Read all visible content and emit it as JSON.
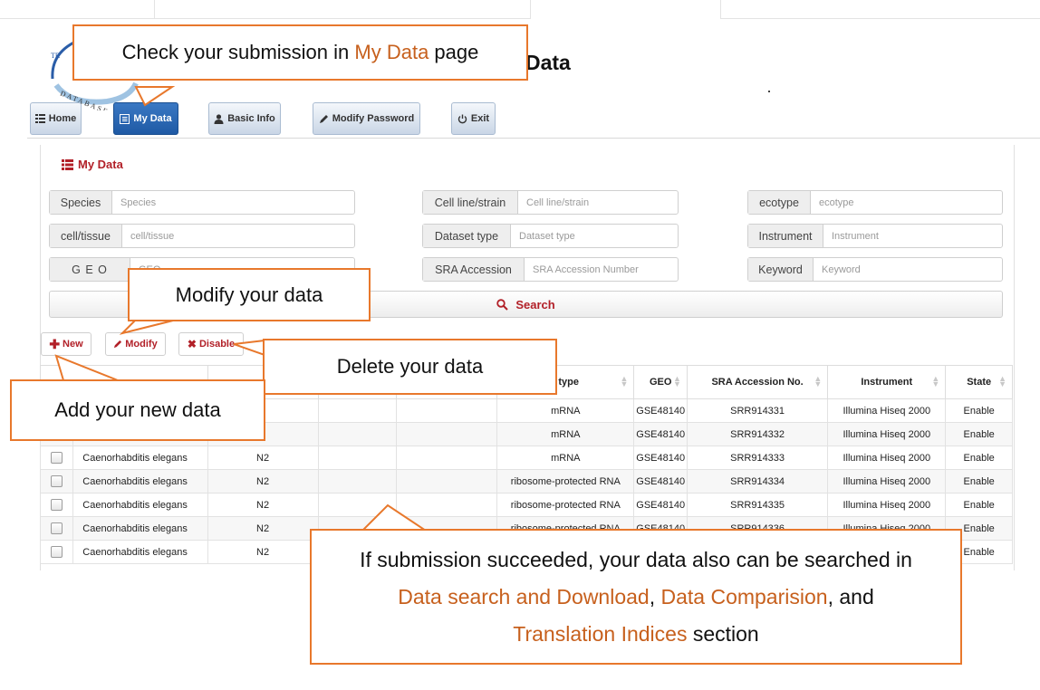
{
  "site": {
    "logo_text_top": "TR",
    "logo_text_bottom": "DATABASE",
    "page_title_suffix": "Data"
  },
  "nav": {
    "buttons": [
      {
        "label": "Home",
        "icon": "grid-icon",
        "active": false
      },
      {
        "label": "My Data",
        "icon": "list-alt-icon",
        "active": true
      },
      {
        "label": "Basic Info",
        "icon": "user-icon",
        "active": false
      },
      {
        "label": "Modify Password",
        "icon": "pencil-icon",
        "active": false
      },
      {
        "label": "Exit",
        "icon": "power-icon",
        "active": false
      }
    ]
  },
  "panel": {
    "title": "My Data",
    "title_icon": "list-icon",
    "fields": [
      {
        "label": "Species",
        "placeholder": "Species",
        "value": ""
      },
      {
        "label": "Cell line/strain",
        "placeholder": "Cell line/strain",
        "value": ""
      },
      {
        "label": "ecotype",
        "placeholder": "ecotype",
        "value": ""
      },
      {
        "label": "cell/tissue",
        "placeholder": "cell/tissue",
        "value": ""
      },
      {
        "label": "Dataset type",
        "placeholder": "Dataset type",
        "value": ""
      },
      {
        "label": "Instrument",
        "placeholder": "Instrument",
        "value": ""
      },
      {
        "label": "G E O",
        "placeholder": "GEO",
        "value": ""
      },
      {
        "label": "SRA Accession",
        "placeholder": "SRA Accession Number",
        "value": ""
      },
      {
        "label": "Keyword",
        "placeholder": "Keyword",
        "value": ""
      }
    ],
    "search_label": "Search",
    "actions": {
      "new": "New",
      "modify": "Modify",
      "disable": "Disable"
    }
  },
  "table": {
    "headers": [
      "",
      "",
      "",
      "",
      "",
      "Dataset type",
      "GEO",
      "SRA Accession No.",
      "Instrument",
      "State"
    ],
    "visible_header_fragments": {
      "col4": "t type"
    },
    "rows": [
      [
        "",
        "",
        "",
        "",
        "",
        "mRNA",
        "GSE48140",
        "SRR914331",
        "Illumina Hiseq 2000",
        "Enable"
      ],
      [
        "",
        "",
        "",
        "",
        "",
        "mRNA",
        "GSE48140",
        "SRR914332",
        "Illumina Hiseq 2000",
        "Enable"
      ],
      [
        "",
        "Caenorhabditis elegans",
        "N2",
        "",
        "",
        "mRNA",
        "GSE48140",
        "SRR914333",
        "Illumina Hiseq 2000",
        "Enable"
      ],
      [
        "",
        "Caenorhabditis elegans",
        "N2",
        "",
        "",
        "ribosome-protected RNA",
        "GSE48140",
        "SRR914334",
        "Illumina Hiseq 2000",
        "Enable"
      ],
      [
        "",
        "Caenorhabditis elegans",
        "N2",
        "",
        "",
        "ribosome-protected RNA",
        "GSE48140",
        "SRR914335",
        "Illumina Hiseq 2000",
        "Enable"
      ],
      [
        "",
        "Caenorhabditis elegans",
        "N2",
        "",
        "",
        "ribosome-protected RNA",
        "GSE48140",
        "SRR914336",
        "Illumina Hiseq 2000",
        "Enable"
      ],
      [
        "",
        "Caenorhabditis elegans",
        "N2",
        "",
        "",
        "",
        "",
        "",
        "",
        "Enable"
      ]
    ]
  },
  "callouts": {
    "check": {
      "pre": "Check your submission in ",
      "link": "My Data",
      "post": " page"
    },
    "modify": "Modify your data",
    "delete": "Delete your data",
    "add": "Add your new data",
    "info": {
      "line1": "If submission succeeded, your data also can be searched in",
      "link1": "Data search and Download",
      "sep1": ", ",
      "link2": "Data Comparision",
      "sep2": ", and",
      "link3": "Translation Indices",
      "post3": " section"
    }
  },
  "colors": {
    "accent_red": "#b22028",
    "callout_border": "#e8782c",
    "callout_link": "#c7601d",
    "nav_active": "#1f5aa5"
  }
}
